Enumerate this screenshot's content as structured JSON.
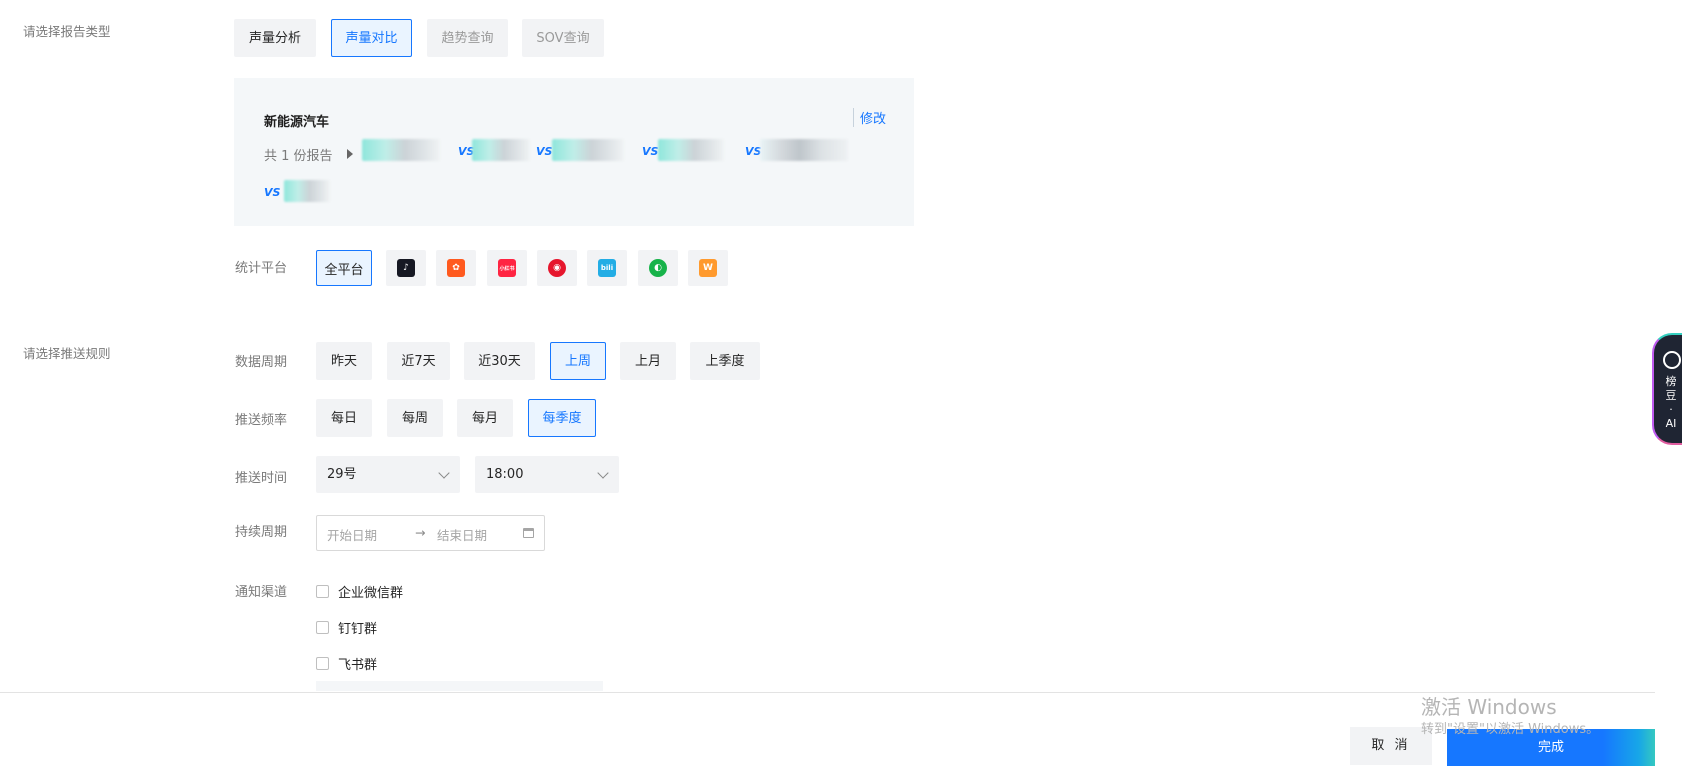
{
  "report_section": {
    "label": "请选择报告类型",
    "types": [
      {
        "label": "声量分析",
        "state": "normal"
      },
      {
        "label": "声量对比",
        "state": "selected"
      },
      {
        "label": "趋势查询",
        "state": "disabled"
      },
      {
        "label": "SOV查询",
        "state": "disabled"
      }
    ]
  },
  "report_card": {
    "title": "新能源汽车",
    "edit_label": "修改",
    "count_text": "共 1 份报告",
    "vs_label": "VS"
  },
  "platform": {
    "label": "统计平台",
    "all_label": "全平台",
    "icons": [
      {
        "name": "douyin-icon",
        "color": "#161823",
        "glyph": "♪"
      },
      {
        "name": "kuaishou-icon",
        "color": "#ff5a1f",
        "glyph": "✿"
      },
      {
        "name": "xiaohongshu-icon",
        "color": "#ff2442",
        "glyph": "小红书"
      },
      {
        "name": "weibo-icon",
        "color": "#e6162d",
        "glyph": "◉"
      },
      {
        "name": "bilibili-icon",
        "color": "#23ade5",
        "glyph": "bili"
      },
      {
        "name": "wechat-channels-icon",
        "color": "#17b34a",
        "glyph": "◐"
      },
      {
        "name": "media-icon",
        "color": "#ff9a2e",
        "glyph": "W"
      }
    ]
  },
  "push_section": {
    "label": "请选择推送规则"
  },
  "period": {
    "label": "数据周期",
    "options": [
      {
        "label": "昨天",
        "selected": false
      },
      {
        "label": "近7天",
        "selected": false
      },
      {
        "label": "近30天",
        "selected": false
      },
      {
        "label": "上周",
        "selected": true
      },
      {
        "label": "上月",
        "selected": false
      },
      {
        "label": "上季度",
        "selected": false
      }
    ]
  },
  "frequency": {
    "label": "推送频率",
    "options": [
      {
        "label": "每日",
        "selected": false
      },
      {
        "label": "每周",
        "selected": false
      },
      {
        "label": "每月",
        "selected": false
      },
      {
        "label": "每季度",
        "selected": true
      }
    ]
  },
  "push_time": {
    "label": "推送时间",
    "day_value": "29号",
    "time_value": "18:00"
  },
  "duration": {
    "label": "持续周期",
    "start_placeholder": "开始日期",
    "arrow": "→",
    "end_placeholder": "结束日期"
  },
  "channels": {
    "label": "通知渠道",
    "options": [
      {
        "label": "企业微信群",
        "checked": false
      },
      {
        "label": "钉钉群",
        "checked": false
      },
      {
        "label": "飞书群",
        "checked": false
      }
    ]
  },
  "footer": {
    "cancel_label": "取 消",
    "done_label": "完成"
  },
  "watermark": {
    "line1": "激活 Windows",
    "line2": "转到\"设置\"以激活 Windows。"
  },
  "ai_tab": {
    "text": "榜\n豆\n·\nAI"
  }
}
